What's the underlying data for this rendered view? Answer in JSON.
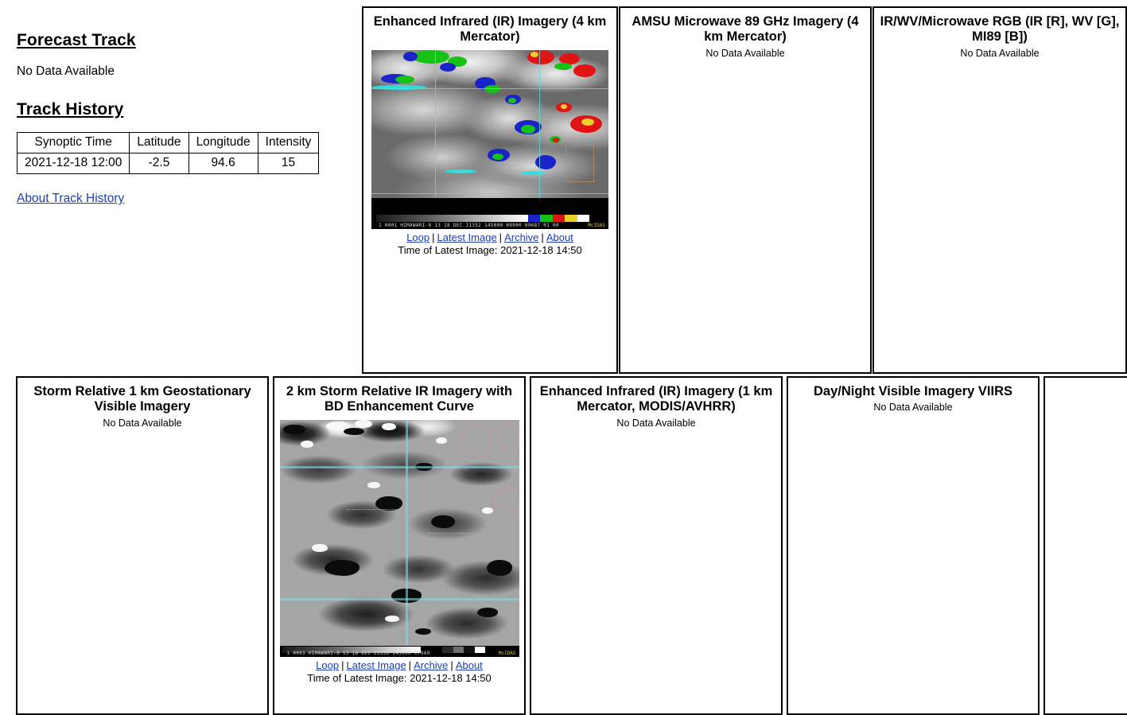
{
  "left": {
    "forecast_title": "Forecast Track",
    "forecast_no_data": "No Data Available",
    "track_history_title": "Track History",
    "table": {
      "headers": [
        "Synoptic Time",
        "Latitude",
        "Longitude",
        "Intensity"
      ],
      "rows": [
        [
          "2021-12-18 12:00",
          "-2.5",
          "94.6",
          "15"
        ]
      ]
    },
    "about_link": "About Track History"
  },
  "common": {
    "no_data": "No Data Available",
    "links": {
      "loop": "Loop",
      "latest_image": "Latest Image",
      "archive": "Archive",
      "about": "About",
      "separator": "|"
    },
    "time_prefix": "Time of Latest Image:"
  },
  "panels": {
    "ir4km": {
      "title": "Enhanced Infrared (IR) Imagery (4 km Mercator)",
      "has_image": true,
      "latest_time": "2021-12-18 14:50",
      "time_line": "Time of Latest Image: 2021-12-18 14:50",
      "image_banner": "1 0001 HIMAWARI-8 13 18 DEC 21352 145000 09900 09687 01 00",
      "image_credit": "McIDAS"
    },
    "amsu89": {
      "title": "AMSU Microwave 89 GHz Imagery (4 km Mercator)",
      "has_image": false,
      "no_data": "No Data Available"
    },
    "rgb": {
      "title": "IR/WV/Microwave RGB (IR [R], WV [G], MI89 [B])",
      "has_image": false,
      "no_data": "No Data Available"
    },
    "stormrel1km": {
      "title": "Storm Relative 1 km Geostationary Visible Imagery",
      "has_image": false,
      "no_data": "No Data Available"
    },
    "bd2km": {
      "title": "2 km Storm Relative IR Imagery with BD Enhancement Curve",
      "has_image": true,
      "latest_time": "2021-12-18 14:50",
      "time_line": "Time of Latest Image: 2021-12-18 14:50",
      "image_banner": "1 0001 HIMAWARI-8 13 18 DEC 21352 145000 07949",
      "image_credit": "McIDAS"
    },
    "ir1km": {
      "title": "Enhanced Infrared (IR) Imagery (1 km Mercator, MODIS/AVHRR)",
      "has_image": false,
      "no_data": "No Data Available"
    },
    "viirs": {
      "title": "Day/Night Visible Imagery VIIRS",
      "has_image": false,
      "no_data": "No Data Available"
    }
  },
  "colors": {
    "link": "#1a3fb0",
    "border": "#000000",
    "background": "#ffffff",
    "enhancement_blue": "#1a23c8",
    "enhancement_green": "#16c216",
    "enhancement_red": "#e01414",
    "enhancement_cyan": "#31dede",
    "enhancement_yellow": "#e8d22b"
  }
}
